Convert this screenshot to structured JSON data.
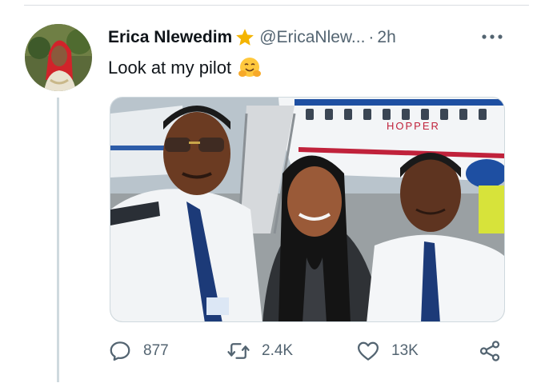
{
  "tweet": {
    "display_name": "Erica Nlewedim",
    "handle": "@EricaNlew...",
    "separator": "·",
    "time": "2h",
    "text": "Look at my pilot",
    "emoji": "hugging-face-emoji",
    "verified_icon": "star-icon"
  },
  "media": {
    "plane_label": "HOPPER"
  },
  "actions": {
    "reply_count": "877",
    "retweet_count": "2.4K",
    "like_count": "13K"
  },
  "icons": {
    "reply": "reply-icon",
    "retweet": "retweet-icon",
    "like": "heart-icon",
    "share": "share-icon",
    "more": "more-icon"
  },
  "colors": {
    "text_primary": "#0f1419",
    "text_secondary": "#536471",
    "star": "#f4b400",
    "thread_line": "#cfd9de"
  }
}
